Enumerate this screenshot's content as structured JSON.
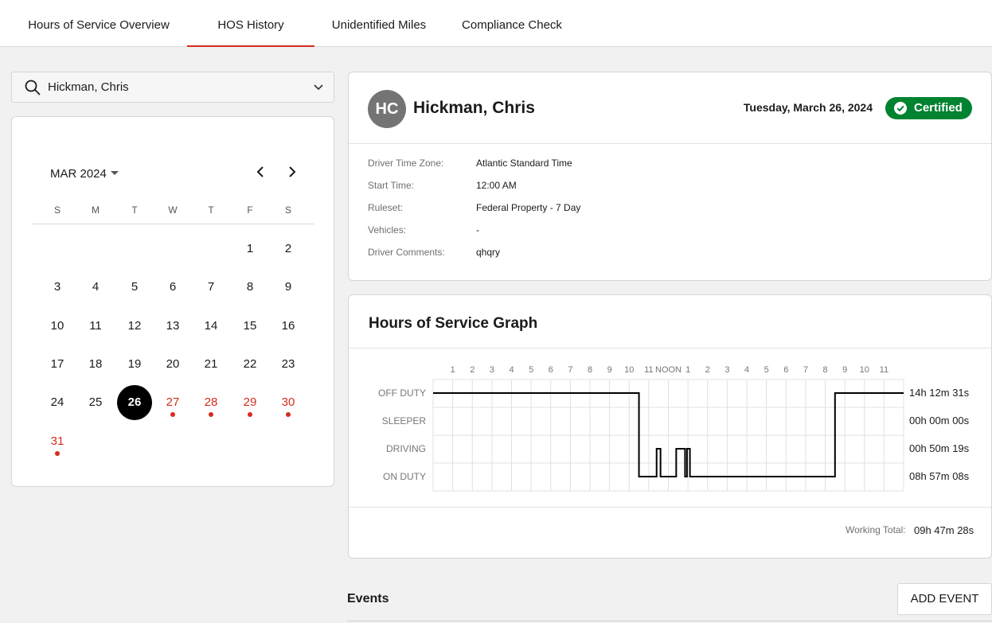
{
  "nav": {
    "tabs": [
      {
        "label": "Hours of Service Overview"
      },
      {
        "label": "HOS History"
      },
      {
        "label": "Unidentified Miles"
      },
      {
        "label": "Compliance Check"
      }
    ],
    "active_tab": "HOS History"
  },
  "search": {
    "value": "Hickman, Chris"
  },
  "calendar": {
    "month_label": "MAR 2024",
    "weekdays": [
      "S",
      "M",
      "T",
      "W",
      "T",
      "F",
      "S"
    ],
    "selected_day": 26,
    "days_with_events": [
      27,
      28,
      29,
      30,
      31
    ],
    "weeks": [
      [
        "",
        "",
        "",
        "",
        "",
        "1",
        "2"
      ],
      [
        "3",
        "4",
        "5",
        "6",
        "7",
        "8",
        "9"
      ],
      [
        "10",
        "11",
        "12",
        "13",
        "14",
        "15",
        "16"
      ],
      [
        "17",
        "18",
        "19",
        "20",
        "21",
        "22",
        "23"
      ],
      [
        "24",
        "25",
        "26",
        "27",
        "28",
        "29",
        "30"
      ],
      [
        "31",
        "",
        "",
        "",
        "",
        "",
        ""
      ]
    ]
  },
  "driver": {
    "initials": "HC",
    "name": "Hickman, Chris",
    "date": "Tuesday, March 26, 2024",
    "status": "Certified",
    "info": [
      {
        "label": "Driver Time Zone:",
        "value": "Atlantic Standard Time"
      },
      {
        "label": "Start Time:",
        "value": "12:00 AM"
      },
      {
        "label": "Ruleset:",
        "value": "Federal Property - 7 Day"
      },
      {
        "label": "Vehicles:",
        "value": "-"
      },
      {
        "label": "Driver Comments:",
        "value": "qhqry"
      }
    ]
  },
  "graph": {
    "title": "Hours of Service Graph",
    "hour_labels": [
      "1",
      "2",
      "3",
      "4",
      "5",
      "6",
      "7",
      "8",
      "9",
      "10",
      "11",
      "NOON",
      "1",
      "2",
      "3",
      "4",
      "5",
      "6",
      "7",
      "8",
      "9",
      "10",
      "11"
    ],
    "rows": [
      {
        "label": "OFF DUTY",
        "total": "14h 12m 31s"
      },
      {
        "label": "SLEEPER",
        "total": "00h 00m 00s"
      },
      {
        "label": "DRIVING",
        "total": "00h 50m 19s"
      },
      {
        "label": "ON DUTY",
        "total": "08h 57m 08s"
      }
    ],
    "working_total_label": "Working Total:",
    "working_total_value": "09h 47m 28s",
    "colors": {
      "line": "#000000",
      "grid": "#e0e0e0"
    }
  },
  "chart_data": {
    "type": "line",
    "x_unit": "hour of day",
    "xlim": [
      0,
      24
    ],
    "categories": [
      "OFF DUTY",
      "SLEEPER",
      "DRIVING",
      "ON DUTY"
    ],
    "status_segments": [
      {
        "status": "OFF DUTY",
        "start": 0,
        "end": 10.5
      },
      {
        "status": "ON DUTY",
        "start": 10.5,
        "end": 11.4
      },
      {
        "status": "DRIVING",
        "start": 11.4,
        "end": 11.6
      },
      {
        "status": "ON DUTY",
        "start": 11.6,
        "end": 12.4
      },
      {
        "status": "DRIVING",
        "start": 12.4,
        "end": 12.85
      },
      {
        "status": "ON DUTY",
        "start": 12.85,
        "end": 12.95
      },
      {
        "status": "DRIVING",
        "start": 12.95,
        "end": 13.1
      },
      {
        "status": "ON DUTY",
        "start": 13.1,
        "end": 20.5
      },
      {
        "status": "OFF DUTY",
        "start": 20.5,
        "end": 24
      }
    ]
  },
  "events": {
    "title": "Events",
    "add_label": "ADD EVENT"
  }
}
